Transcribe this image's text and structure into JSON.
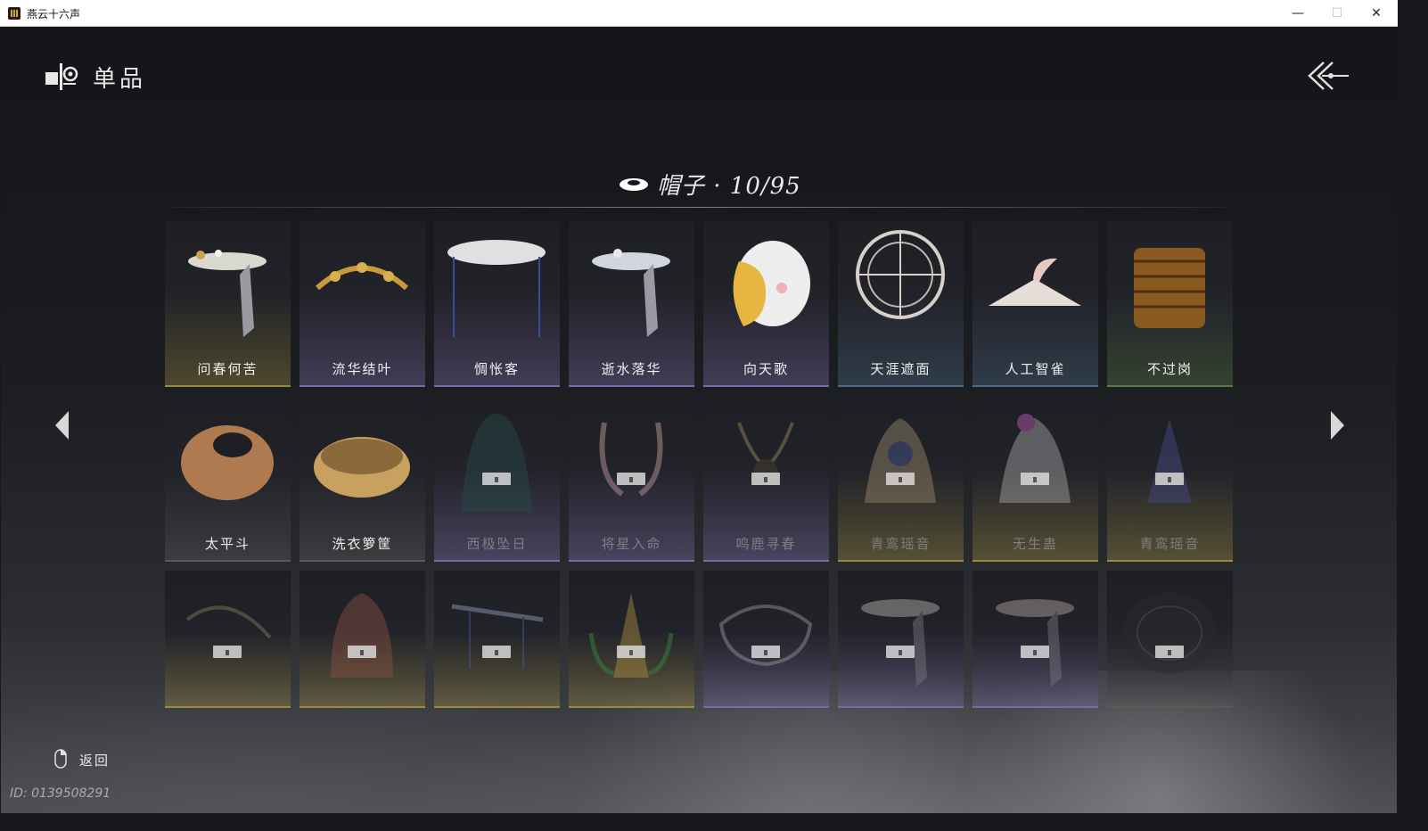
{
  "window": {
    "title": "燕云十六声",
    "minimize": "—",
    "maximize": "☐",
    "close": "✕"
  },
  "header": {
    "title": "单品",
    "back_icon": "double-chevron-left-icon"
  },
  "category": {
    "label": "帽子 · 10/95",
    "icon": "hat-icon"
  },
  "nav": {
    "prev_icon": "triangle-left-icon",
    "next_icon": "triangle-right-icon"
  },
  "items": [
    {
      "name": "问春何苦",
      "rarity_color": "#9a8a3e",
      "locked": false
    },
    {
      "name": "流华结叶",
      "rarity_color": "#7b6aa6",
      "locked": false
    },
    {
      "name": "惆怅客",
      "rarity_color": "#7b6aa6",
      "locked": false
    },
    {
      "name": "逝水落华",
      "rarity_color": "#7b6aa6",
      "locked": false
    },
    {
      "name": "向天歌",
      "rarity_color": "#7b6aa6",
      "locked": false
    },
    {
      "name": "天涯遮面",
      "rarity_color": "#4e6a86",
      "locked": false
    },
    {
      "name": "人工智雀",
      "rarity_color": "#4e6a86",
      "locked": false
    },
    {
      "name": "不过岗",
      "rarity_color": "#5a7a45",
      "locked": false
    },
    {
      "name": "太平斗",
      "rarity_color": "#5a5a5a",
      "locked": false
    },
    {
      "name": "洗衣箩筐",
      "rarity_color": "#5a5a5a",
      "locked": false
    },
    {
      "name": "西极坠日",
      "rarity_color": "#7b6aa6",
      "locked": true
    },
    {
      "name": "将星入命",
      "rarity_color": "#7b6aa6",
      "locked": true
    },
    {
      "name": "鸣鹿寻春",
      "rarity_color": "#7b6aa6",
      "locked": true
    },
    {
      "name": "青鸾瑶音",
      "rarity_color": "#9a8a3e",
      "locked": true
    },
    {
      "name": "无生蛊",
      "rarity_color": "#9a8a3e",
      "locked": true
    },
    {
      "name": "青鸾瑶音",
      "rarity_color": "#9a8a3e",
      "locked": true
    },
    {
      "name": "",
      "rarity_color": "#9a8a3e",
      "locked": true
    },
    {
      "name": "",
      "rarity_color": "#9a8a3e",
      "locked": true
    },
    {
      "name": "",
      "rarity_color": "#9a8a3e",
      "locked": true
    },
    {
      "name": "",
      "rarity_color": "#9a8a3e",
      "locked": true
    },
    {
      "name": "",
      "rarity_color": "#7b6aa6",
      "locked": true
    },
    {
      "name": "",
      "rarity_color": "#7b6aa6",
      "locked": true
    },
    {
      "name": "",
      "rarity_color": "#7b6aa6",
      "locked": true
    },
    {
      "name": "",
      "rarity_color": "#5a5a5a",
      "locked": true
    }
  ],
  "footer": {
    "back_label": "返回",
    "mouse_icon": "mouse-right-click-icon"
  },
  "user": {
    "id_label": "ID: 0139508291"
  }
}
